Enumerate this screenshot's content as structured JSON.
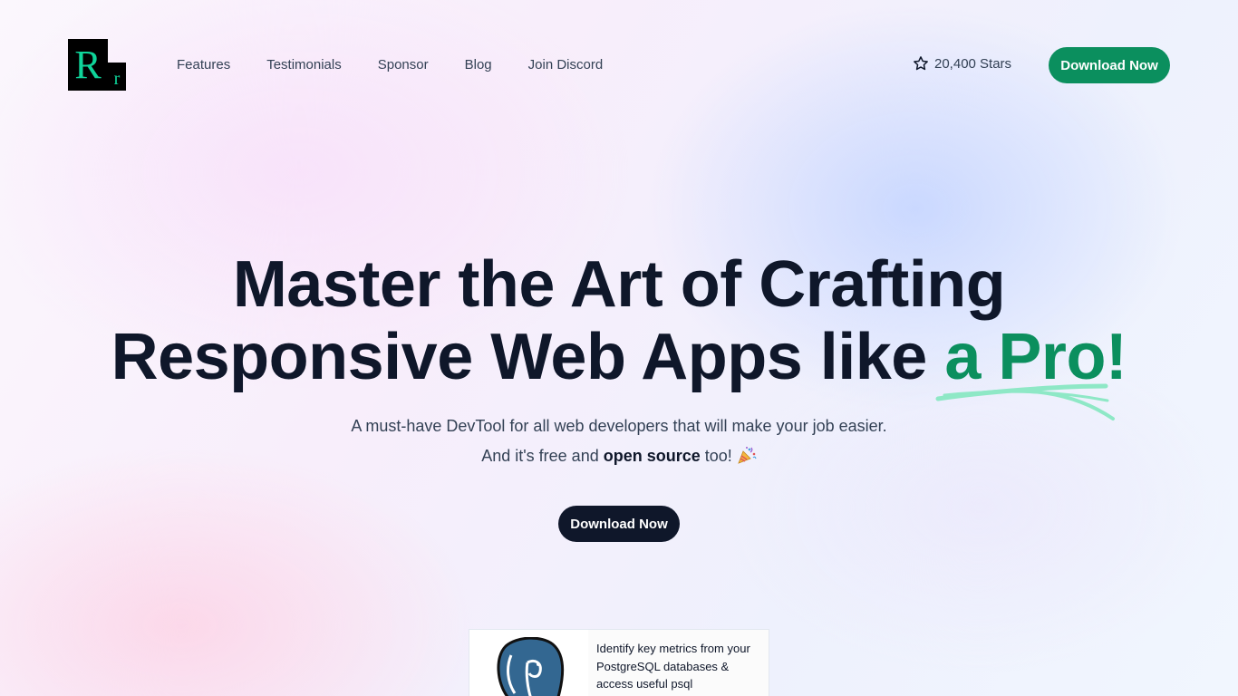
{
  "brand": {
    "logo_big": "R",
    "logo_small": "r"
  },
  "nav": {
    "items": [
      {
        "label": "Features"
      },
      {
        "label": "Testimonials"
      },
      {
        "label": "Sponsor"
      },
      {
        "label": "Blog"
      },
      {
        "label": "Join Discord"
      }
    ]
  },
  "header": {
    "stars_label": "20,400 Stars",
    "download_label": "Download Now"
  },
  "hero": {
    "headline_line1": "Master the Art of Crafting",
    "headline_line2_main": "Responsive Web Apps like ",
    "headline_line2_accent": "a Pro!",
    "subtitle_line1": "A must-have DevTool for all web developers that will make your job easier.",
    "subtitle_line2_before": "And it's free and ",
    "subtitle_line2_bold": "open source",
    "subtitle_line2_after": " too! ",
    "download_label": "Download Now"
  },
  "sponsor": {
    "text": "Identify key metrics from your PostgreSQL databases & access useful psql"
  },
  "colors": {
    "accent": "#0b8f5e",
    "dark": "#0f172a",
    "underline": "#8ee8c6"
  }
}
